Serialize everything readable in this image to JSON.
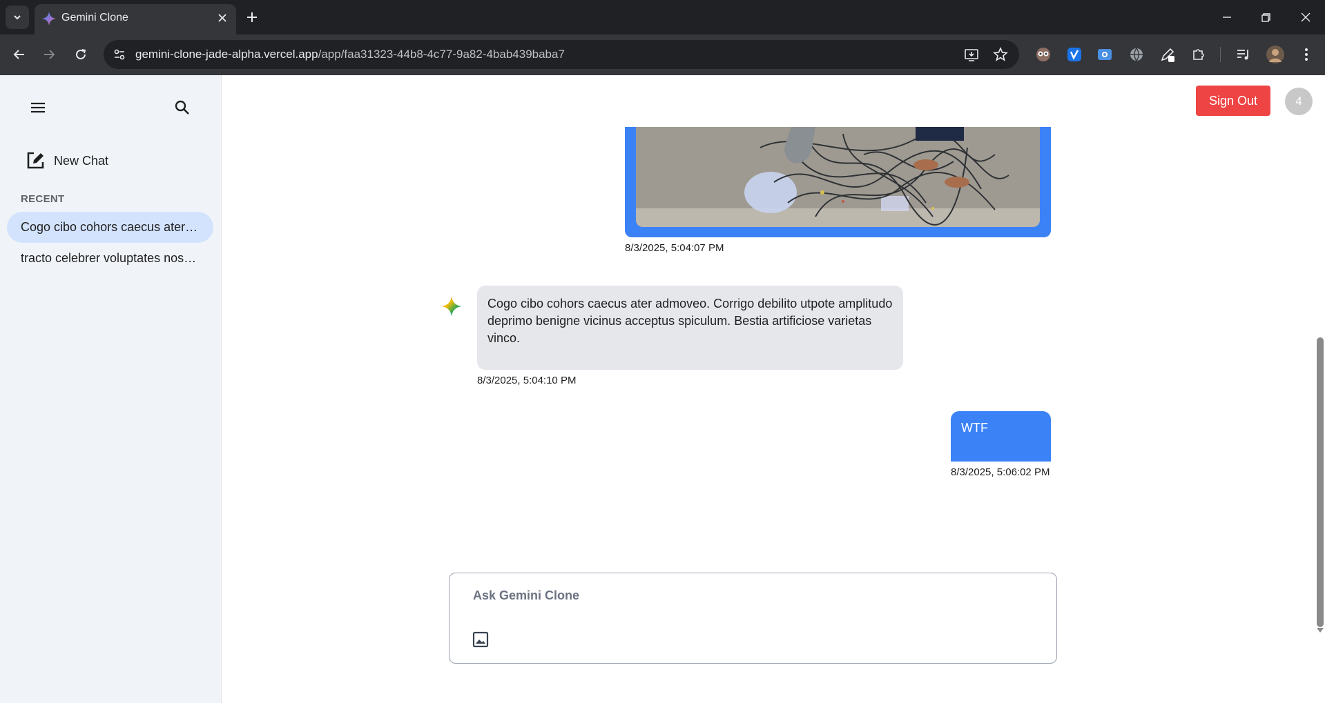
{
  "browser": {
    "tab_title": "Gemini Clone",
    "url_domain": "gemini-clone-jade-alpha.vercel.app",
    "url_path": "/app/faa31323-44b8-4c77-9a82-4bab439baba7"
  },
  "sidebar": {
    "new_chat_label": "New Chat",
    "recent_label": "RECENT",
    "chats": [
      {
        "title": "Cogo cibo cohors caecus ater admoveo.",
        "active": true
      },
      {
        "title": "tracto celebrer voluptates nostrum",
        "active": false
      }
    ]
  },
  "header": {
    "signout_label": "Sign Out",
    "avatar_initial": "4",
    "signout_color": "#ef4444"
  },
  "messages": [
    {
      "role": "user",
      "type": "image",
      "timestamp": "8/3/2025, 5:04:07 PM"
    },
    {
      "role": "model",
      "type": "text",
      "text": "Cogo cibo cohors caecus ater admoveo. Corrigo debilito utpote amplitudo deprimo benigne vicinus acceptus spiculum. Bestia artificiose varietas vinco.",
      "timestamp": "8/3/2025, 5:04:10 PM"
    },
    {
      "role": "user",
      "type": "text",
      "text": "WTF",
      "timestamp": "8/3/2025, 5:06:02 PM"
    }
  ],
  "composer": {
    "placeholder": "Ask Gemini Clone"
  },
  "colors": {
    "user_bubble": "#3b82f6",
    "bot_bubble": "#e5e7eb",
    "sidebar_bg": "#f0f4f9",
    "active_chat": "#d3e3fd"
  }
}
